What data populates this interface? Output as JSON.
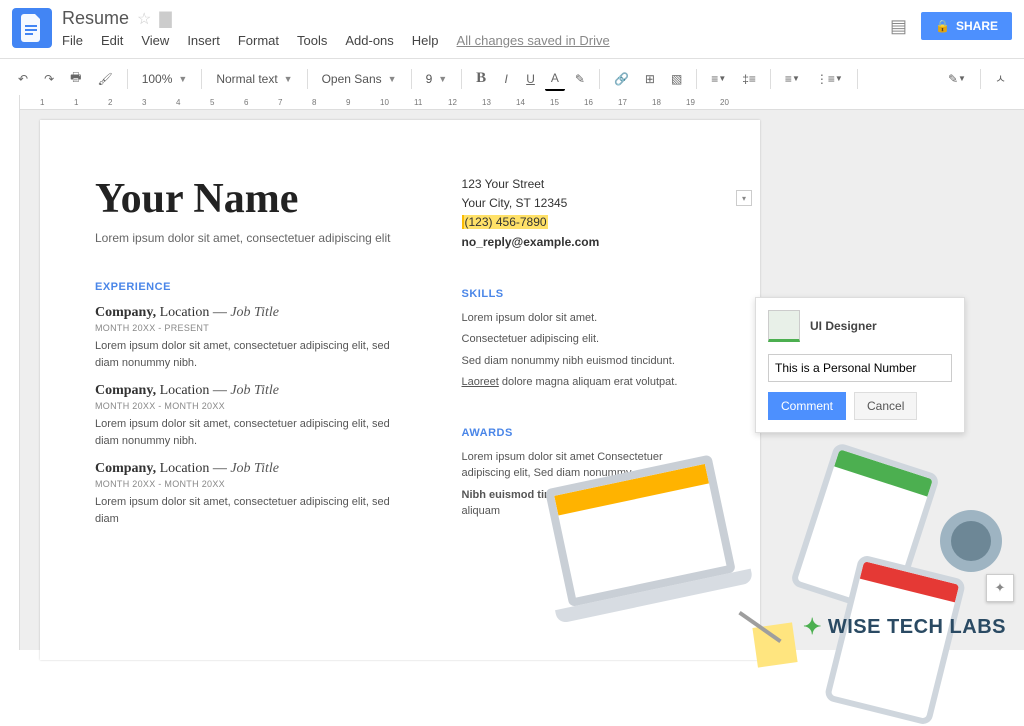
{
  "header": {
    "doc_title": "Resume",
    "saved_msg": "All changes saved in Drive",
    "share_label": "SHARE",
    "menus": [
      "File",
      "Edit",
      "View",
      "Insert",
      "Format",
      "Tools",
      "Add-ons",
      "Help"
    ]
  },
  "toolbar": {
    "zoom": "100%",
    "style": "Normal text",
    "font": "Open Sans",
    "font_size": "9"
  },
  "document": {
    "name": "Your Name",
    "tagline": "Lorem ipsum dolor sit amet, consectetuer adipiscing elit",
    "contact": {
      "street": "123 Your Street",
      "city": "Your City, ST 12345",
      "phone": "(123) 456-7890",
      "email": "no_reply@example.com"
    },
    "sect_experience": "EXPERIENCE",
    "sect_skills": "SKILLS",
    "sect_awards": "AWARDS",
    "jobs": [
      {
        "company": "Company,",
        "location": "Location",
        "dash": "—",
        "title": "Job Title",
        "period": "MONTH 20XX - PRESENT",
        "desc": "Lorem ipsum dolor sit amet, consectetuer adipiscing elit, sed diam nonummy nibh."
      },
      {
        "company": "Company,",
        "location": "Location",
        "dash": "—",
        "title": "Job Title",
        "period": "MONTH 20XX - MONTH 20XX",
        "desc": "Lorem ipsum dolor sit amet, consectetuer adipiscing elit, sed diam nonummy nibh."
      },
      {
        "company": "Company,",
        "location": "Location",
        "dash": "—",
        "title": "Job Title",
        "period": "MONTH 20XX - MONTH 20XX",
        "desc": "Lorem ipsum dolor sit amet, consectetuer adipiscing elit, sed diam"
      }
    ],
    "skills": {
      "l1": "Lorem ipsum dolor sit amet.",
      "l2": "Consectetuer adipiscing elit.",
      "l3": "Sed diam nonummy nibh euismod tincidunt.",
      "l4a": "Laoreet",
      "l4b": " dolore magna aliquam erat volutpat."
    },
    "awards": {
      "l1": "Lorem ipsum dolor sit amet Consectetuer adipiscing elit, Sed diam nonummy",
      "l2a": "Nibh euismod tincidunt",
      "l2b": " ut laoreet dolore magna aliquam"
    }
  },
  "comment": {
    "author": "UI Designer",
    "text": "This is a Personal Number",
    "btn_primary": "Comment",
    "btn_cancel": "Cancel"
  },
  "ruler_marks": [
    "1",
    "1",
    "2",
    "3",
    "4",
    "5",
    "6",
    "7",
    "8",
    "9",
    "10",
    "11",
    "12",
    "13",
    "14",
    "15",
    "16",
    "17",
    "18",
    "19",
    "20"
  ],
  "brand": "WISE TECH LABS"
}
